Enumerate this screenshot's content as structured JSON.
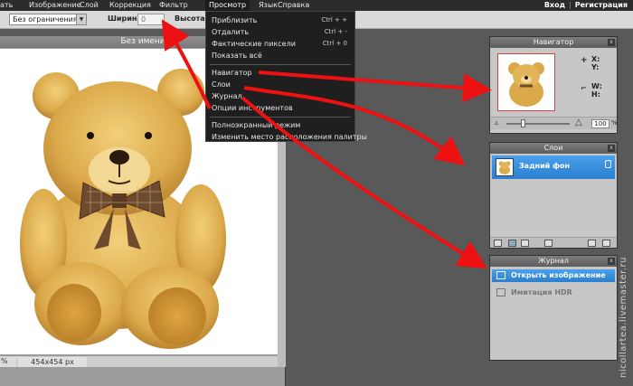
{
  "menubar": {
    "items": [
      {
        "label": "ать"
      },
      {
        "label": "Изображение"
      },
      {
        "label": "Слой"
      },
      {
        "label": "Коррекция"
      },
      {
        "label": "Фильтр"
      },
      {
        "label": "Просмотр"
      },
      {
        "label": "Язык"
      },
      {
        "label": "Справка"
      }
    ],
    "login": "Вход",
    "separator": "|",
    "register": "Регистрация"
  },
  "toolbar": {
    "constraint_value": "Без ограничения",
    "width_label": "Ширина:",
    "width_value": "0",
    "height_label": "Высота:"
  },
  "document": {
    "title": "Без имени",
    "zoom": "%",
    "dimensions": "454x454 px"
  },
  "view_menu": {
    "items": [
      {
        "label": "Приблизить",
        "shortcut": "Ctrl + +"
      },
      {
        "label": "Отдалить",
        "shortcut": "Ctrl + -"
      },
      {
        "label": "Фактические пиксели",
        "shortcut": "Ctrl + 0"
      },
      {
        "label": "Показать всё",
        "shortcut": ""
      },
      {
        "label": "Навигатор",
        "shortcut": ""
      },
      {
        "label": "Слои",
        "shortcut": ""
      },
      {
        "label": "Журнал",
        "shortcut": ""
      },
      {
        "label": "Опции инструментов",
        "shortcut": ""
      },
      {
        "label": "Полноэкранный режим",
        "shortcut": ""
      },
      {
        "label": "Изменить место расположения палитры",
        "shortcut": ""
      }
    ]
  },
  "navigator": {
    "title": "Навигатор",
    "close": "x",
    "x_label": "X:",
    "y_label": "Y:",
    "w_label": "W:",
    "h_label": "H:",
    "zoom_value": "100",
    "zoom_unit": "%"
  },
  "layers": {
    "title": "Слои",
    "close": "x",
    "layer_name": "Задний фон"
  },
  "history": {
    "title": "Журнал",
    "close": "x",
    "items": [
      {
        "label": "Открыть изображение"
      },
      {
        "label": "Имитация HDR"
      }
    ]
  },
  "watermark": "nicollartea.livemaster.ru",
  "colors": {
    "arrow": "#ee1111",
    "selection": "#2f86d6",
    "menu_bg": "#1f1f1f"
  }
}
